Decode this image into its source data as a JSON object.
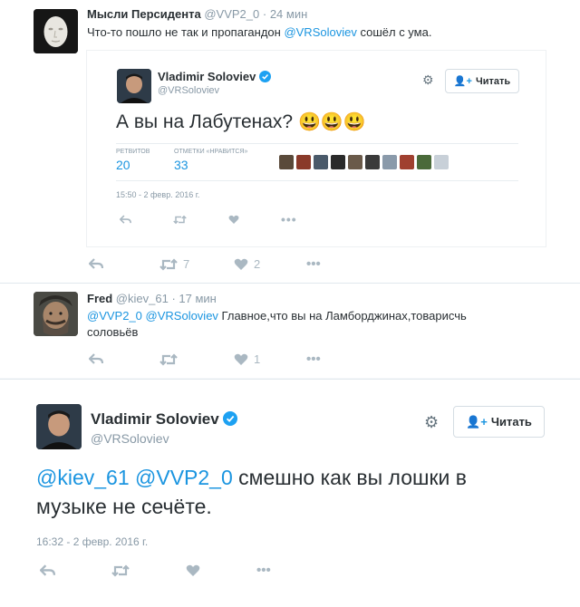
{
  "tweet1": {
    "name": "Мысли Персидента",
    "handle": "@VVP2_0",
    "dot": "·",
    "time": "24 мин",
    "text_before": "Что-то пошло не так и пропагандон ",
    "text_mention": "@VRSoloviev",
    "text_after": " сошёл с ума.",
    "retweets": "7",
    "likes": "2"
  },
  "embedded": {
    "name": "Vladimir Soloviev",
    "handle": "@VRSoloviev",
    "follow_label": "Читать",
    "text": "А вы на Лабутенах?",
    "emoji": "😃😃😃",
    "retweets_label": "РЕТВИТОВ",
    "retweets_value": "20",
    "likes_label": "ОТМЕТКИ «НРАВИТСЯ»",
    "likes_value": "33",
    "timestamp": "15:50 - 2 февр. 2016 г.",
    "thumb_colors": [
      "#5a4a3a",
      "#8a3a2a",
      "#4a5a6a",
      "#2a2a2a",
      "#6a5a4a",
      "#3a3a3a",
      "#8a9aaa",
      "#a04030",
      "#4a6a3a",
      "#c8d0d8"
    ]
  },
  "tweet2": {
    "name": "Fred",
    "handle": "@kiev_61",
    "dot": "·",
    "time": "17 мин",
    "mention1": "@VVP2_0",
    "mention2": "@VRSoloviev",
    "text_line1": " Главное,что вы на Ламборджинах,товарисчь",
    "text_line2": "соловьёв",
    "likes": "1"
  },
  "tweet3": {
    "name": "Vladimir Soloviev",
    "handle": "@VRSoloviev",
    "follow_label": "Читать",
    "mention1": "@kiev_61",
    "mention2": "@VVP2_0",
    "text_line1": " смешно как вы лошки в",
    "text_line2": "музыке не сечёте.",
    "timestamp": "16:32 - 2 февр. 2016 г."
  },
  "colors": {
    "link": "#1b95e0",
    "verified": "#1da1f2",
    "icon": "#aab8c2"
  }
}
